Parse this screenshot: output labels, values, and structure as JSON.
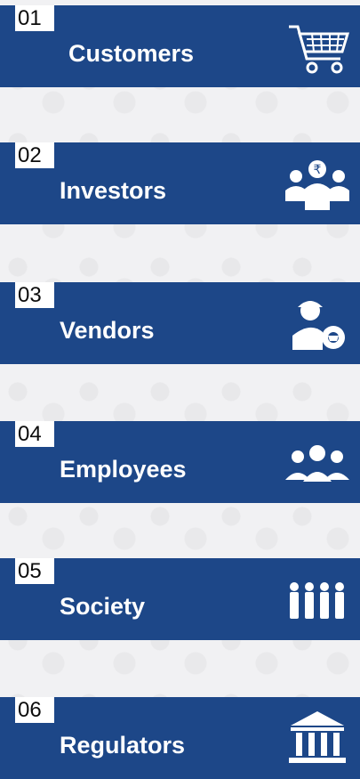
{
  "items": [
    {
      "number": "01",
      "label": "Customers",
      "icon": "shopping-cart-icon"
    },
    {
      "number": "02",
      "label": "Investors",
      "icon": "investors-group-icon"
    },
    {
      "number": "03",
      "label": "Vendors",
      "icon": "vendor-gear-icon"
    },
    {
      "number": "04",
      "label": "Employees",
      "icon": "people-group-icon"
    },
    {
      "number": "05",
      "label": "Society",
      "icon": "society-people-icon"
    },
    {
      "number": "06",
      "label": "Regulators",
      "icon": "bank-building-icon"
    }
  ],
  "colors": {
    "card_background": "#1d4788",
    "number_tab_background": "#ffffff",
    "page_background": "#f1f1f3"
  }
}
